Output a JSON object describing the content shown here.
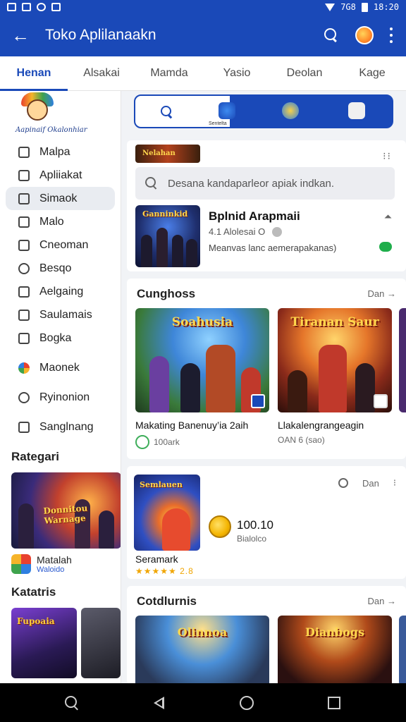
{
  "status_bar": {
    "network": "7G8",
    "time": "18:20"
  },
  "app_bar": {
    "title": "Toko Aplilanaakn"
  },
  "tabs": [
    {
      "label": "Henan"
    },
    {
      "label": "Alsakai"
    },
    {
      "label": "Mamda"
    },
    {
      "label": "Yasio"
    },
    {
      "label": "Deolan"
    },
    {
      "label": "Kage"
    }
  ],
  "sidebar": {
    "logo_text": "Aapinaif Okalonhiar",
    "items": [
      {
        "label": "Malpa",
        "icon": "bag-icon"
      },
      {
        "label": "Apliiakat",
        "icon": "app-icon"
      },
      {
        "label": "Simaok",
        "icon": "tag-icon"
      },
      {
        "label": "Malo",
        "icon": "store-icon"
      },
      {
        "label": "Cneoman",
        "icon": "lock-icon"
      },
      {
        "label": "Besqo",
        "icon": "compass-icon"
      },
      {
        "label": "Aelgaing",
        "icon": "square-icon"
      },
      {
        "label": "Saulamais",
        "icon": "bag-icon"
      },
      {
        "label": "Bogka",
        "icon": "bag-icon"
      },
      {
        "label": "Maonek",
        "icon": "colorwheel-icon"
      },
      {
        "label": "Ryinonion",
        "icon": "search-icon"
      },
      {
        "label": "Sanglnang",
        "icon": "square-icon"
      }
    ],
    "section_1": "Rategari",
    "banner_title": "Donnitou Warnage",
    "app_name": "Matalah",
    "app_sub": "Waloido",
    "section_2": "Katatris",
    "thumb_title": "Fupoaia"
  },
  "main": {
    "quick_caption": "Sentelta",
    "mini_banner": "Nelahan",
    "search_placeholder": "Desana kandaparleor apiak indkan.",
    "featured": {
      "thumb_title": "Ganninkid",
      "title": "Bplnid Arapmaii",
      "rating": "4.1 Alolesai O",
      "desc": "Meanvas lanc aemerapakanas)"
    },
    "section_trending": "Cunghoss",
    "see_more": "Dan →",
    "games": [
      {
        "art_title": "Soahusia",
        "name": "Makating Banenuy’ia 2aih",
        "sub": "100ark"
      },
      {
        "art_title": "Tiranan Saur",
        "name": "Llakalengrangeagin",
        "sub": "OAN 6 (sao)"
      }
    ],
    "promo": {
      "art_title": "Semlauen",
      "name": "Seramark",
      "stars": "★★★★★ 2.8",
      "price": "100.10",
      "price_sub": "Bialolco",
      "more": "Dan"
    },
    "section_bottom": "Cotdlurnis",
    "bottom_art": [
      "Olinnoa",
      "Dianbogs"
    ]
  }
}
